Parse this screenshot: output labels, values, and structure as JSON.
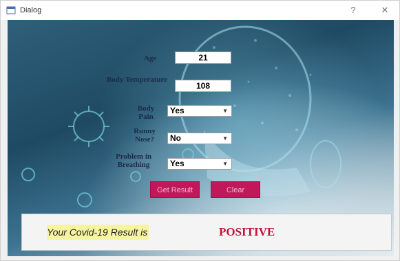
{
  "window": {
    "title": "Dialog",
    "help_glyph": "?",
    "close_glyph": "✕"
  },
  "form": {
    "age": {
      "label": "Age",
      "value": "21"
    },
    "temperature": {
      "label": "Body Temperature",
      "value": "108"
    },
    "body_pain": {
      "label": "Body Pain",
      "value": "Yes"
    },
    "runny_nose": {
      "label": "Runny Nose?",
      "value": "No"
    },
    "breathing": {
      "label": "Problem in Breathing",
      "value": "Yes"
    }
  },
  "buttons": {
    "get_result": "Get Result",
    "clear": "Clear"
  },
  "result": {
    "label": "Your Covid-19 Result is",
    "value": "POSITIVE"
  },
  "colors": {
    "button_bg": "#c2185b",
    "result_value": "#c0123a",
    "result_label_bg": "#f7f4a0"
  }
}
